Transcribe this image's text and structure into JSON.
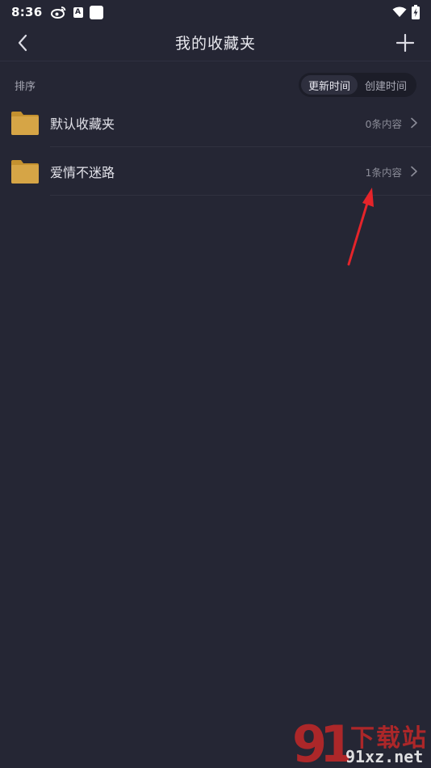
{
  "status_bar": {
    "time": "8:36",
    "a_badge": "A"
  },
  "nav": {
    "title": "我的收藏夹",
    "back_icon": "chevron-left-icon",
    "add_icon": "plus-icon"
  },
  "sort": {
    "label": "排序",
    "options": [
      {
        "label": "更新时间",
        "active": true
      },
      {
        "label": "创建时间",
        "active": false
      }
    ]
  },
  "folders": [
    {
      "name": "默认收藏夹",
      "count": "0条内容"
    },
    {
      "name": "爱情不迷路",
      "count": "1条内容"
    }
  ],
  "watermark": {
    "brand_cn": "下载站",
    "url": "91xz.net",
    "logo_digits": "91"
  },
  "colors": {
    "background": "#252634",
    "folder": "#d4a043",
    "annotation_arrow": "#e5242a",
    "watermark_red": "#c42828"
  }
}
